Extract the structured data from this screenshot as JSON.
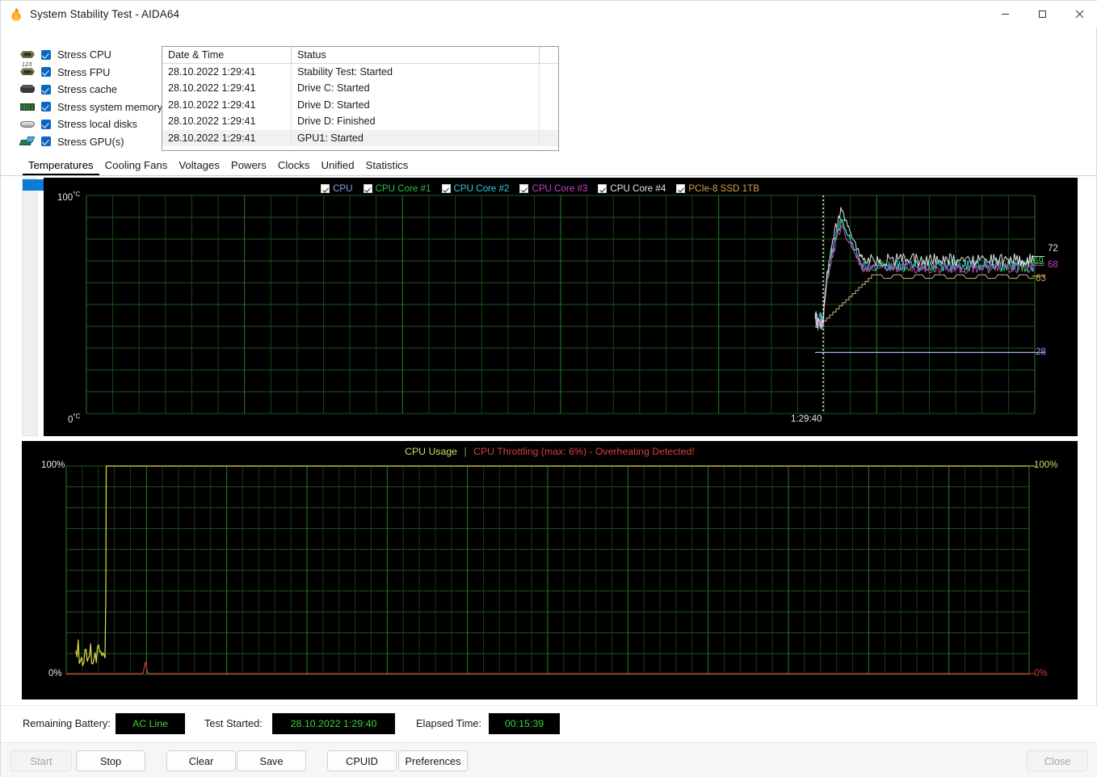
{
  "window": {
    "title": "System Stability Test - AIDA64",
    "icon": "flame-icon",
    "minimize_label": "Minimize",
    "maximize_label": "Maximize",
    "close_label": "Close"
  },
  "stress_options": [
    {
      "label": "Stress CPU",
      "icon": "cpu-chip-icon",
      "checked": true
    },
    {
      "label": "Stress FPU",
      "icon": "fpu-chip-icon",
      "checked": true
    },
    {
      "label": "Stress cache",
      "icon": "cache-chip-icon",
      "checked": true
    },
    {
      "label": "Stress system memory",
      "icon": "memory-ram-icon",
      "checked": true
    },
    {
      "label": "Stress local disks",
      "icon": "hard-disk-icon",
      "checked": true
    },
    {
      "label": "Stress GPU(s)",
      "icon": "gpu-card-icon",
      "checked": true
    }
  ],
  "log": {
    "columns": [
      "Date & Time",
      "Status"
    ],
    "rows": [
      {
        "datetime": "28.10.2022 1:29:41",
        "status": "Stability Test: Started",
        "selected": false
      },
      {
        "datetime": "28.10.2022 1:29:41",
        "status": "Drive C: Started",
        "selected": false
      },
      {
        "datetime": "28.10.2022 1:29:41",
        "status": "Drive D: Started",
        "selected": false
      },
      {
        "datetime": "28.10.2022 1:29:41",
        "status": "Drive D: Finished",
        "selected": false
      },
      {
        "datetime": "28.10.2022 1:29:41",
        "status": "GPU1: Started",
        "selected": true
      }
    ]
  },
  "tabs": [
    {
      "label": "Temperatures",
      "active": true
    },
    {
      "label": "Cooling Fans",
      "active": false
    },
    {
      "label": "Voltages",
      "active": false
    },
    {
      "label": "Powers",
      "active": false
    },
    {
      "label": "Clocks",
      "active": false
    },
    {
      "label": "Unified",
      "active": false
    },
    {
      "label": "Statistics",
      "active": false
    }
  ],
  "temperature_chart": {
    "legend": [
      {
        "label": "CPU",
        "color": "#8f9ef0",
        "checked": true
      },
      {
        "label": "CPU Core #1",
        "color": "#2fbf4a",
        "checked": true
      },
      {
        "label": "CPU Core #2",
        "color": "#35c8d8",
        "checked": true
      },
      {
        "label": "CPU Core #3",
        "color": "#cc3fc9",
        "checked": true
      },
      {
        "label": "CPU Core #4",
        "color": "#e6e6e6",
        "checked": true
      },
      {
        "label": "PCIe-8 SSD 1TB",
        "color": "#d8a24a",
        "checked": true
      }
    ],
    "y_top_label": "100",
    "y_top_unit": "°C",
    "y_bottom_label": "0",
    "y_bottom_unit": "°C",
    "time_marker_label": "1:29:40",
    "current_values": [
      {
        "value": "72",
        "color": "#e6e6e6"
      },
      {
        "value": "69",
        "color": "#2fbf4a"
      },
      {
        "value": "68",
        "color": "#cc3fc9"
      },
      {
        "value": "63",
        "color": "#d8a24a"
      },
      {
        "value": "28",
        "color": "#8f9ef0"
      }
    ]
  },
  "usage_chart": {
    "title_primary": "CPU Usage",
    "title_separator": "|",
    "title_warning": "CPU Throttling (max: 6%) - Overheating Detected!",
    "y_left_top": "100%",
    "y_left_bottom": "0%",
    "y_right_top": "100%",
    "y_right_bottom": "0%",
    "usage_color": "#e0e04a",
    "throttle_color": "#cc3b33"
  },
  "status": {
    "battery_label": "Remaining Battery:",
    "battery_value": "AC Line",
    "started_label": "Test Started:",
    "started_value": "28.10.2022 1:29:40",
    "elapsed_label": "Elapsed Time:",
    "elapsed_value": "00:15:39"
  },
  "buttons": [
    {
      "label": "Start",
      "disabled": true
    },
    {
      "label": "Stop",
      "disabled": false
    },
    {
      "label": "Clear",
      "disabled": false
    },
    {
      "label": "Save",
      "disabled": false
    },
    {
      "label": "CPUID",
      "disabled": false
    },
    {
      "label": "Preferences",
      "disabled": false
    },
    {
      "label": "Close",
      "disabled": true
    }
  ],
  "chart_data": [
    {
      "type": "line",
      "title": "Temperatures",
      "xlabel": "",
      "ylabel": "°C",
      "ylim": [
        0,
        100
      ],
      "grid": true,
      "legend_position": "top-right",
      "x_tick_labels": [
        "1:29:40"
      ],
      "series": [
        {
          "name": "CPU",
          "color": "#8f9ef0",
          "current": 28,
          "plateau": 28,
          "note": "flat line near 28°C across the whole recorded window"
        },
        {
          "name": "CPU Core #1",
          "color": "#2fbf4a",
          "current": 69,
          "plateau": 69,
          "note": "noisy band 64-74°C after load spike"
        },
        {
          "name": "CPU Core #2",
          "color": "#35c8d8",
          "current": 69,
          "plateau": 69,
          "note": "noisy band 64-74°C after load spike"
        },
        {
          "name": "CPU Core #3",
          "color": "#cc3fc9",
          "current": 68,
          "plateau": 68,
          "note": "noisy band 63-73°C after load spike"
        },
        {
          "name": "CPU Core #4",
          "color": "#e6e6e6",
          "current": 72,
          "plateau": 72,
          "note": "upper envelope, peak spike to ~94°C at test start"
        },
        {
          "name": "PCIe-8 SSD 1TB",
          "color": "#d8a24a",
          "current": 63,
          "plateau": 63,
          "note": "stepped ramp from ~40°C to 62-64°C square wave"
        }
      ],
      "annotations": [
        {
          "text": "1:29:40",
          "kind": "time-marker",
          "style": "white dotted vertical line"
        },
        {
          "text": "72",
          "kind": "value-label",
          "color": "#e6e6e6"
        },
        {
          "text": "69",
          "kind": "value-label",
          "color": "#2fbf4a"
        },
        {
          "text": "68",
          "kind": "value-label",
          "color": "#cc3fc9"
        },
        {
          "text": "63",
          "kind": "value-label",
          "color": "#d8a24a"
        },
        {
          "text": "28",
          "kind": "value-label",
          "color": "#8f9ef0"
        }
      ]
    },
    {
      "type": "line",
      "title": "CPU Usage | CPU Throttling (max: 6%) - Overheating Detected!",
      "xlabel": "",
      "ylabel": "%",
      "ylim": [
        0,
        100
      ],
      "grid": true,
      "legend_position": "none",
      "series": [
        {
          "name": "CPU Usage",
          "color": "#e0e04a",
          "current": 100,
          "note": "idle 5-12% jitter then vertical jump to 100% held flat"
        },
        {
          "name": "CPU Throttling",
          "color": "#cc3b33",
          "current": 0,
          "max": 6,
          "note": "flat at 0% with a single 6% spike near the start"
        }
      ]
    }
  ]
}
